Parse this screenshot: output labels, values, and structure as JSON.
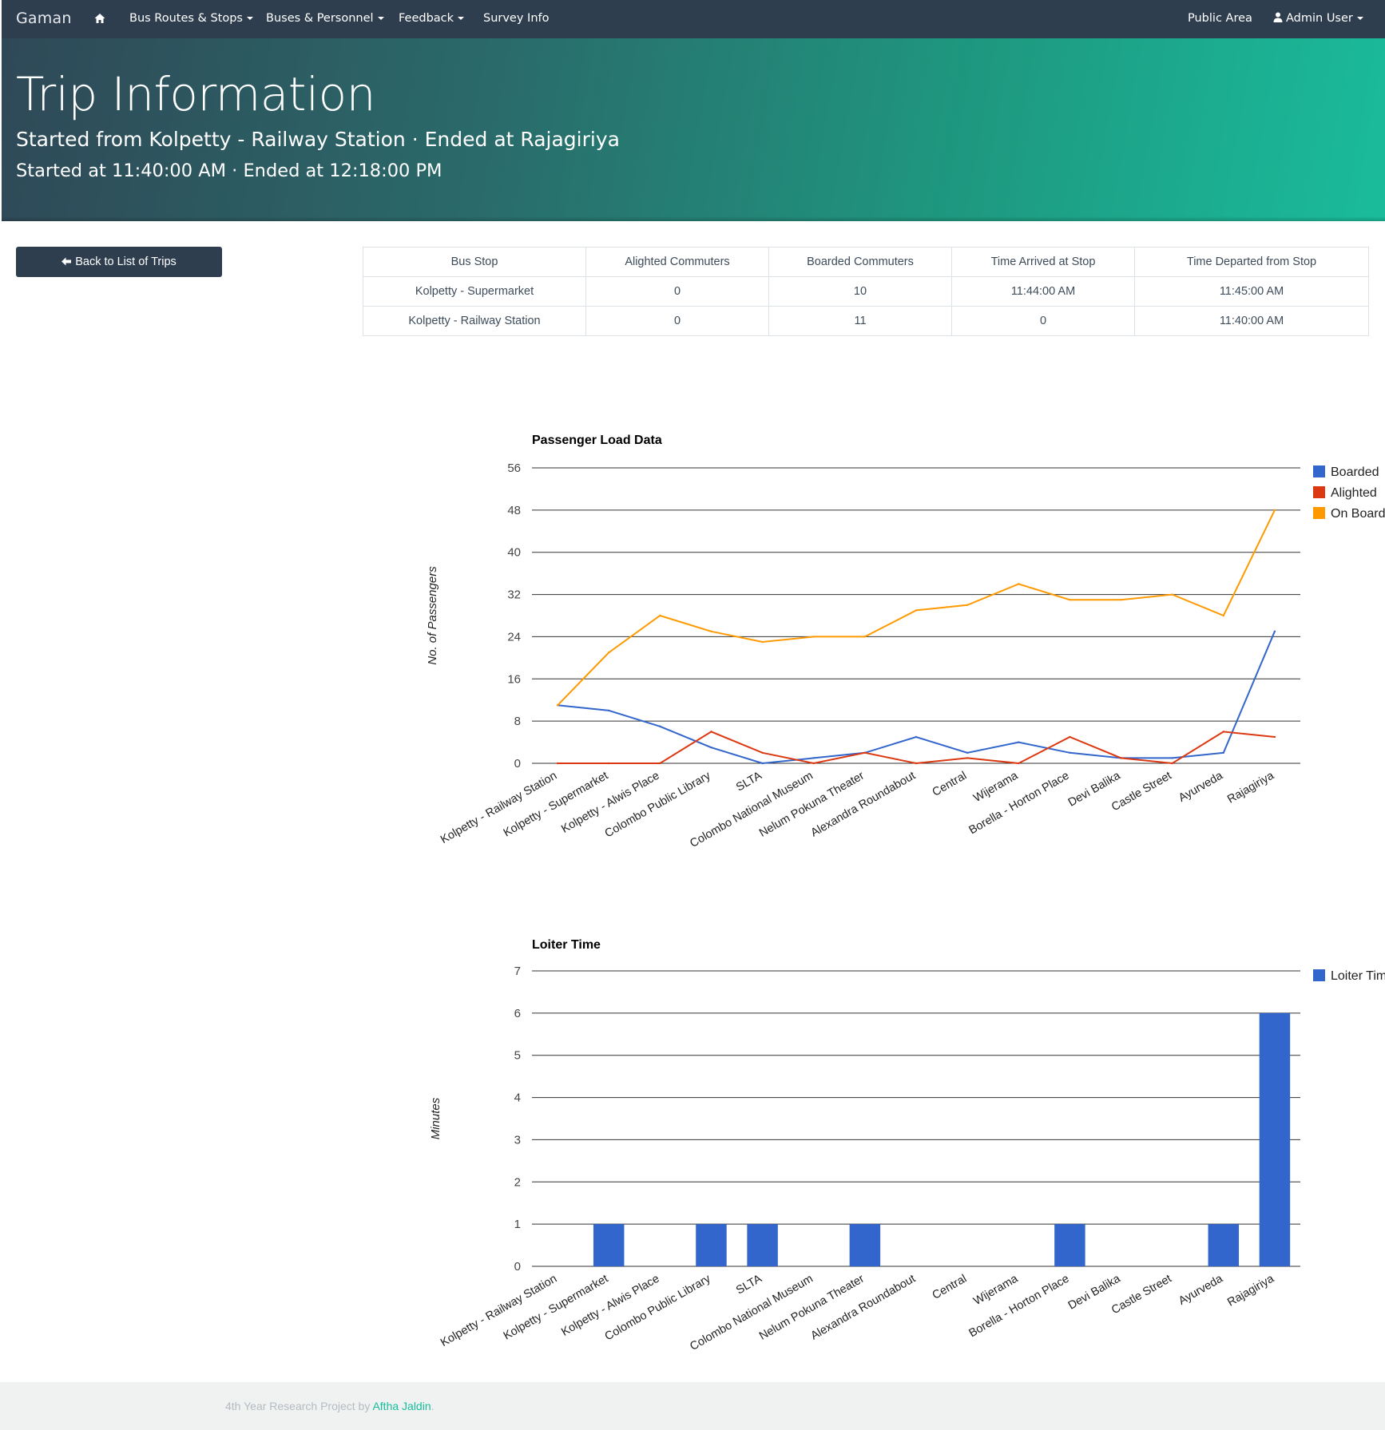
{
  "navbar": {
    "brand": "Gaman",
    "home_icon": "home-icon",
    "items": [
      "Bus Routes & Stops",
      "Buses & Personnel",
      "Feedback",
      "Survey Info"
    ],
    "public_area": "Public Area",
    "user": "Admin User",
    "user_icon": "user-icon"
  },
  "header": {
    "title": "Trip Information",
    "route_line": "Started from Kolpetty - Railway Station · Ended at Rajagiriya",
    "time_line": "Started at 11:40:00 AM · Ended at 12:18:00 PM"
  },
  "back_button": {
    "label": "Back to List of Trips",
    "icon": "arrow-left-icon"
  },
  "table": {
    "headers": [
      "Bus Stop",
      "Alighted Commuters",
      "Boarded Commuters",
      "Time Arrived at Stop",
      "Time Departed from Stop"
    ],
    "rows": [
      [
        "Kolpetty - Supermarket",
        "0",
        "10",
        "11:44:00 AM",
        "11:45:00 AM"
      ],
      [
        "Kolpetty - Railway Station",
        "0",
        "11",
        "0",
        "11:40:00 AM"
      ]
    ]
  },
  "chart_data": [
    {
      "type": "line",
      "title": "Passenger Load Data",
      "xlabel": "",
      "ylabel": "No. of Passengers",
      "ylim": [
        0,
        56
      ],
      "yticks": [
        0,
        8,
        16,
        24,
        32,
        40,
        48,
        56
      ],
      "grid": true,
      "legend_position": "right",
      "categories": [
        "Kolpetty - Railway Station",
        "Kolpetty - Supermarket",
        "Kolpetty - Alwis Place",
        "Colombo Public Library",
        "SLTA",
        "Colombo National Museum",
        "Nelum Pokuna Theater",
        "Alexandra Roundabout",
        "Central",
        "Wijerama",
        "Borella - Horton Place",
        "Devi Balika",
        "Castle Street",
        "Ayurveda",
        "Rajagiriya"
      ],
      "series": [
        {
          "name": "Boarded",
          "color": "#3366cc",
          "values": [
            11,
            10,
            7,
            3,
            0,
            1,
            2,
            5,
            2,
            4,
            2,
            1,
            1,
            2,
            25
          ]
        },
        {
          "name": "Alighted",
          "color": "#dc3912",
          "values": [
            0,
            0,
            0,
            6,
            2,
            0,
            2,
            0,
            1,
            0,
            5,
            1,
            0,
            6,
            5
          ]
        },
        {
          "name": "On Board",
          "color": "#ff9900",
          "values": [
            11,
            21,
            28,
            25,
            23,
            24,
            24,
            29,
            30,
            34,
            31,
            31,
            32,
            28,
            48
          ]
        }
      ]
    },
    {
      "type": "bar",
      "title": "Loiter Time",
      "xlabel": "",
      "ylabel": "Minutes",
      "ylim": [
        0,
        7
      ],
      "yticks": [
        0,
        1,
        2,
        3,
        4,
        5,
        6,
        7
      ],
      "grid": true,
      "legend_position": "right",
      "categories": [
        "Kolpetty - Railway Station",
        "Kolpetty - Supermarket",
        "Kolpetty - Alwis Place",
        "Colombo Public Library",
        "SLTA",
        "Colombo National Museum",
        "Nelum Pokuna Theater",
        "Alexandra Roundabout",
        "Central",
        "Wijerama",
        "Borella - Horton Place",
        "Devi Balika",
        "Castle Street",
        "Ayurveda",
        "Rajagiriya"
      ],
      "series": [
        {
          "name": "Loiter Tim",
          "color": "#3366cc",
          "values": [
            0,
            1,
            0,
            1,
            1,
            0,
            1,
            0,
            0,
            0,
            1,
            0,
            0,
            1,
            6
          ]
        }
      ]
    }
  ],
  "footer": {
    "prefix": "4th Year Research Project by ",
    "author": "Aftha Jaldin",
    "suffix": "."
  }
}
